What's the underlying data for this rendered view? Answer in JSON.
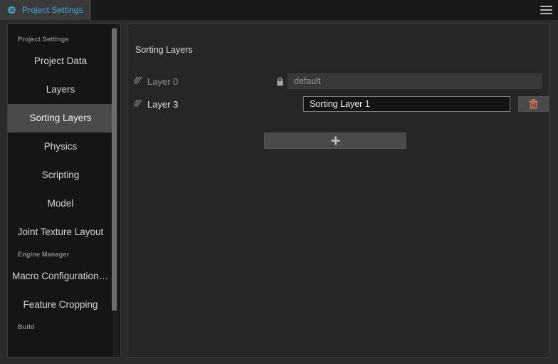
{
  "window": {
    "tab": {
      "label": "Project Settings",
      "icon": "gear-icon",
      "accent_color": "#41a9d0"
    },
    "menu_icon": "hamburger-menu-icon"
  },
  "sidebar": {
    "groups": [
      {
        "header": "Project Settings",
        "items": [
          {
            "label": "Project Data",
            "selected": false
          },
          {
            "label": "Layers",
            "selected": false
          },
          {
            "label": "Sorting Layers",
            "selected": true
          },
          {
            "label": "Physics",
            "selected": false
          },
          {
            "label": "Scripting",
            "selected": false
          },
          {
            "label": "Model",
            "selected": false
          },
          {
            "label": "Joint Texture Layout",
            "selected": false
          }
        ]
      },
      {
        "header": "Engine Manager",
        "items": [
          {
            "label": "Macro Configurations…",
            "selected": false
          },
          {
            "label": "Feature Cropping",
            "selected": false
          }
        ]
      },
      {
        "header": "Build",
        "items": []
      }
    ]
  },
  "main": {
    "title": "Sorting Layers",
    "rows": [
      {
        "handle_icon": "drag-handle-icon",
        "name": "Layer 0",
        "locked": true,
        "lock_icon": "lock-icon",
        "value": "default",
        "editable": false,
        "deletable": false
      },
      {
        "handle_icon": "drag-handle-icon",
        "name": "Layer 3",
        "locked": false,
        "lock_icon": "",
        "value": "Sorting Layer 1",
        "editable": true,
        "deletable": true,
        "delete_icon": "trash-icon"
      }
    ],
    "add_button": {
      "label": "+",
      "icon": "plus-icon"
    }
  }
}
